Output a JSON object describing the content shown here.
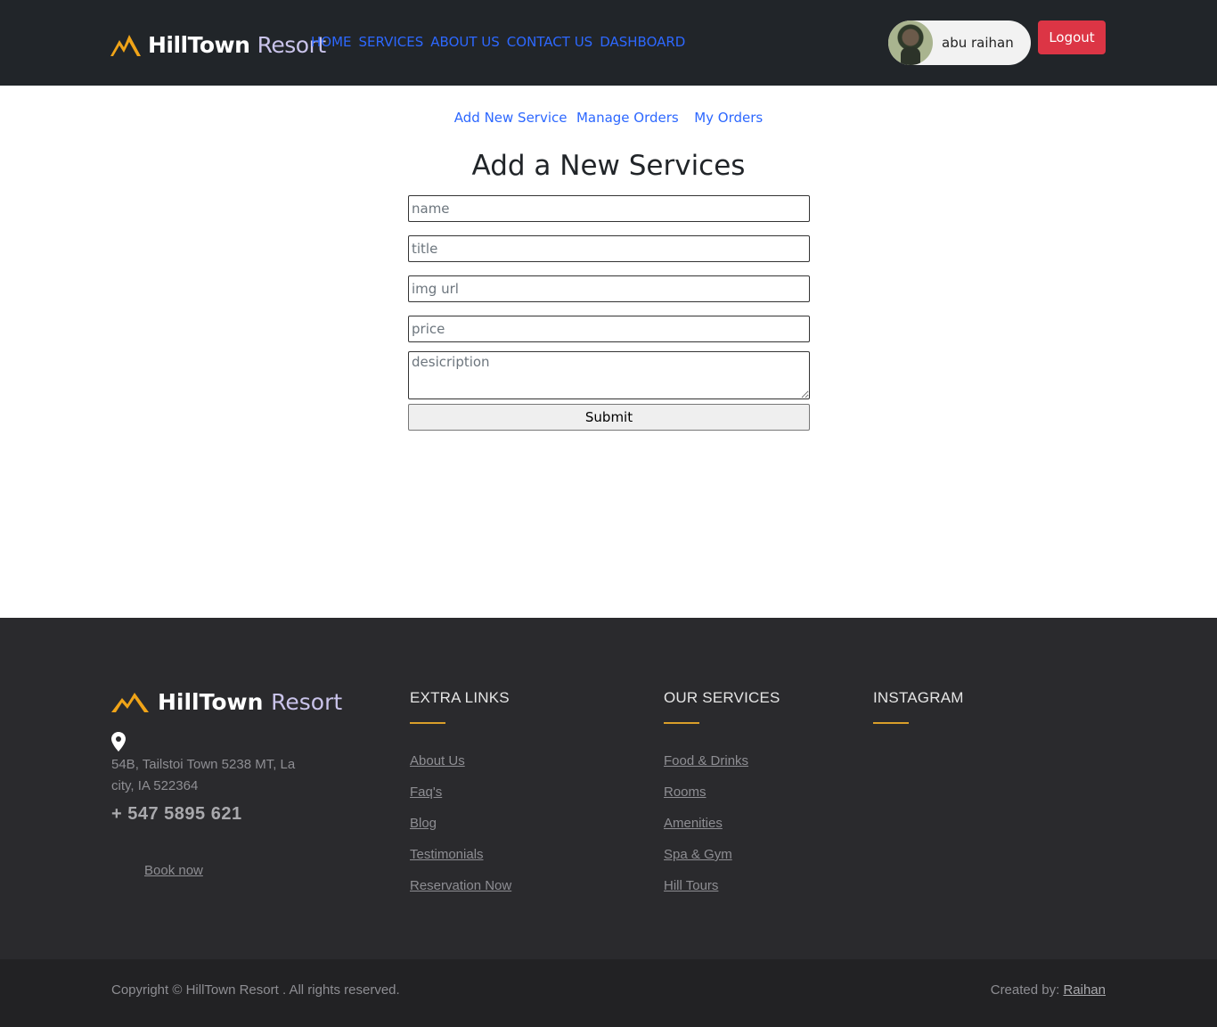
{
  "brand": {
    "name_bold": "HillTown",
    "name_light": "Resort"
  },
  "nav": [
    "HOME",
    "SERVICES",
    "ABOUT US",
    "CONTACT US",
    "DASHBOARD"
  ],
  "user": {
    "name": "abu raihan",
    "logout_label": "Logout"
  },
  "subnav": [
    "Add New Service",
    "Manage Orders",
    "My Orders"
  ],
  "form": {
    "title": "Add a New Services",
    "name_placeholder": "name",
    "title_placeholder": "title",
    "img_placeholder": "img url",
    "price_placeholder": "price",
    "description_placeholder": "desicription",
    "submit_label": "Submit"
  },
  "footer": {
    "address": "54B, Tailstoi Town 5238 MT, La city, IA 522364",
    "phone": "+ 547 5895 621",
    "book_now": "Book now",
    "extra_links": {
      "heading": "EXTRA LINKS",
      "items": [
        "About Us",
        "Faq's",
        "Blog",
        "Testimonials",
        "Reservation Now"
      ]
    },
    "services": {
      "heading": "OUR SERVICES",
      "items": [
        "Food & Drinks",
        "Rooms",
        "Amenities",
        "Spa & Gym",
        "Hill Tours"
      ]
    },
    "instagram": {
      "heading": "INSTAGRAM"
    },
    "copyright": "Copyright © HillTown Resort . All rights reserved.",
    "created_by": "Created by:",
    "creator": "Raihan"
  },
  "colors": {
    "header_bg": "#212529",
    "link": "#2d68ff",
    "logout": "#dc3545",
    "accent_gold": "#d99e2a",
    "footer_bg": "#2a2a2d"
  }
}
